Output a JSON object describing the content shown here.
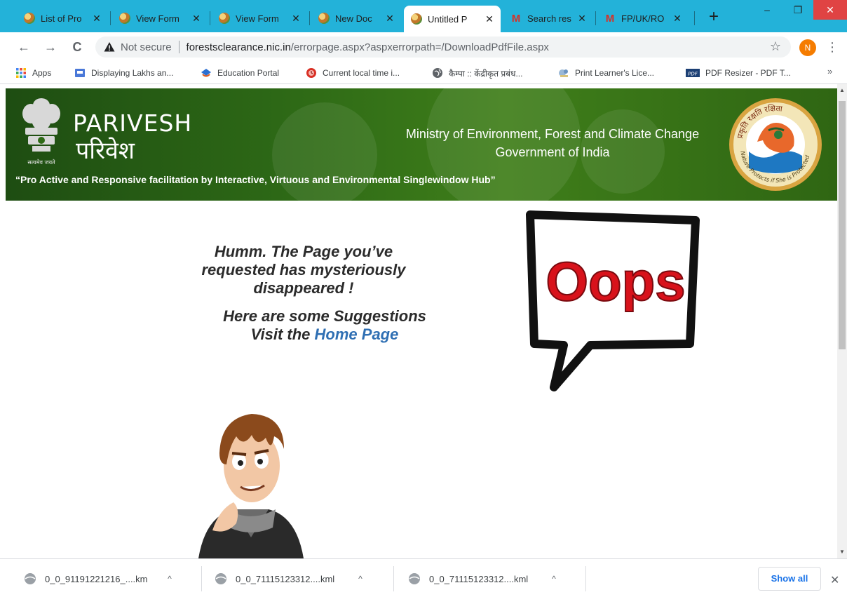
{
  "window": {
    "minimize": "‒",
    "maximize": "❐",
    "close": "✕"
  },
  "tabs": [
    {
      "label": "List of Pro",
      "icon": "mef-icon",
      "active": false
    },
    {
      "label": "View Form",
      "icon": "mef-icon",
      "active": false
    },
    {
      "label": "View Form",
      "icon": "mef-icon",
      "active": false
    },
    {
      "label": "New Doc",
      "icon": "mef-icon",
      "active": false
    },
    {
      "label": "Untitled P",
      "icon": "mef-icon",
      "active": true
    },
    {
      "label": "Search res",
      "icon": "gmail-icon",
      "active": false
    },
    {
      "label": "FP/UK/RO",
      "icon": "gmail-icon",
      "active": false
    }
  ],
  "tab_close_glyph": "✕",
  "new_tab_glyph": "+",
  "toolbar": {
    "back": "←",
    "forward": "→",
    "reload": "C",
    "not_secure": "Not secure",
    "url_host": "forestsclearance.nic.in",
    "url_path": "/errorpage.aspx?aspxerrorpath=/DownloadPdfFile.aspx",
    "star": "☆",
    "profile_initial": "N",
    "menu": "⋮"
  },
  "bookmarks": [
    {
      "label": "Apps",
      "icon": "apps-grid-icon"
    },
    {
      "label": "Displaying Lakhs an...",
      "icon": "slides-icon"
    },
    {
      "label": "Education Portal",
      "icon": "education-portal-icon"
    },
    {
      "label": "Current local time i...",
      "icon": "clock-icon"
    },
    {
      "label": "कैम्पा :: केंद्रीकृत प्रबंध...",
      "icon": "globe-icon"
    },
    {
      "label": "Print Learner's Lice...",
      "icon": "license-icon"
    },
    {
      "label": "PDF Resizer - PDF T...",
      "icon": "pdf-resizer-icon"
    }
  ],
  "bookmarks_more": "»",
  "banner": {
    "brand_en": "PARIVESH",
    "brand_hi": "परिवेश",
    "emblem_caption": "सत्यमेव जयते",
    "ministry_line1": "Ministry of Environment, Forest and Climate Change",
    "ministry_line2": "Government of India",
    "tagline": "“Pro Active and Responsive facilitation by Interactive, Virtuous and Environmental Singlewindow Hub”",
    "seal_text_top": "प्रकृति रक्षति रक्षिता",
    "seal_text_bottom": "Nature Protects if She is Protected"
  },
  "error": {
    "line1": "Humm. The Page you’ve",
    "line2": "requested has mysteriously",
    "line3": "disappeared !",
    "suggest": "Here are some Suggestions",
    "visit": "Visit the",
    "home_link": "Home Page",
    "oops": "Oops"
  },
  "scrollbar": {
    "up": "▲",
    "down": "▼"
  },
  "downloads": [
    {
      "name": "0_0_91191221216_....km",
      "chevron": "^"
    },
    {
      "name": "0_0_71115123312....kml",
      "chevron": "^"
    },
    {
      "name": "0_0_71115123312....kml",
      "chevron": "^"
    }
  ],
  "downloads_show_all": "Show all",
  "downloads_close": "✕",
  "colors": {
    "tab_strip": "#23b2d9",
    "banner_green": "#2e6a16",
    "link_blue": "#2f6fb3",
    "oops_red": "#d8121b"
  }
}
